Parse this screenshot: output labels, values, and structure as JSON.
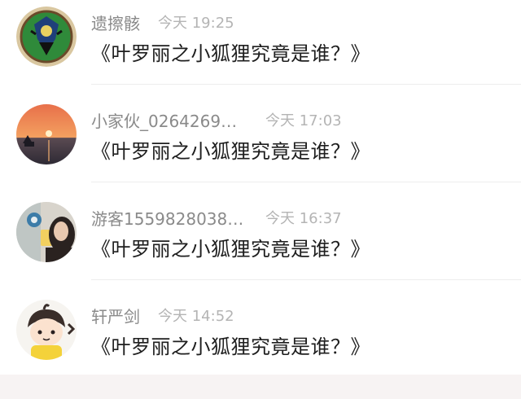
{
  "comments": [
    {
      "name": "遗擦骸",
      "time": "今天 19:25",
      "title": "《叶罗丽之小狐狸究竟是谁？》",
      "avatar": "tribal-emblem-avatar"
    },
    {
      "name": "小家伙_02642699...",
      "time": "今天 17:03",
      "title": "《叶罗丽之小狐狸究竟是谁？》",
      "avatar": "sunset-sea-avatar"
    },
    {
      "name": "游客15598280380...",
      "time": "今天 16:37",
      "title": "《叶罗丽之小狐狸究竟是谁？》",
      "avatar": "selfie-photo-avatar"
    },
    {
      "name": "轩严剑",
      "time": "今天 14:52",
      "title": "《叶罗丽之小狐狸究竟是谁？》",
      "avatar": "cartoon-boy-avatar"
    }
  ],
  "colors": {
    "name": "#8a8a8a",
    "time": "#b4b4b4",
    "title": "#1e1e1e",
    "divider": "#ededed"
  }
}
